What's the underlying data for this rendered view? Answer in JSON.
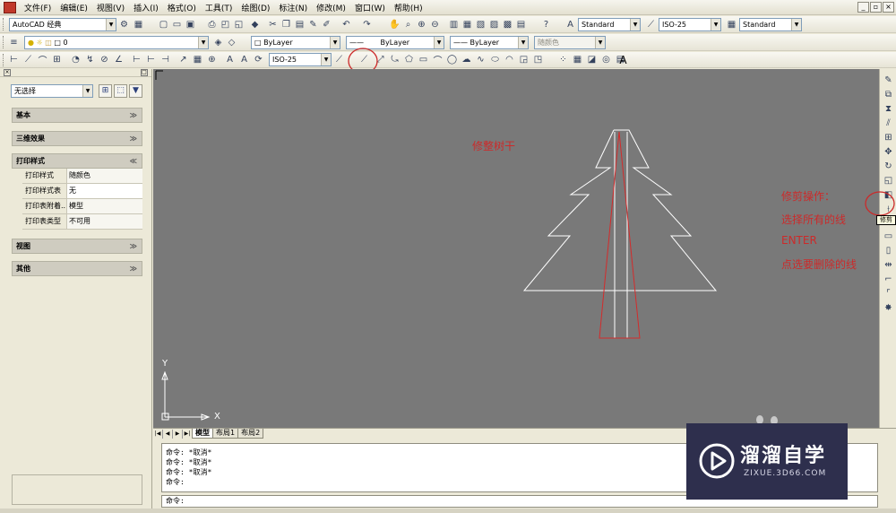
{
  "menubar": {
    "items": [
      "文件(F)",
      "编辑(E)",
      "视图(V)",
      "插入(I)",
      "格式(O)",
      "工具(T)",
      "绘图(D)",
      "标注(N)",
      "修改(M)",
      "窗口(W)",
      "帮助(H)"
    ],
    "window_controls": [
      "_",
      "▫",
      "×"
    ]
  },
  "toolbar1": {
    "workspace": "AutoCAD 经典",
    "text_style": "Standard",
    "dim_style": "ISO-25",
    "table_style": "Standard"
  },
  "toolbar2": {
    "layer": "0",
    "color": "ByLayer",
    "linetype": "ByLayer",
    "lineweight": "ByLayer",
    "plot_style": "随颜色"
  },
  "toolbar3": {
    "dim_style": "ISO-25",
    "text_icon": "A"
  },
  "palette": {
    "selection": "无选择",
    "sections": {
      "basic": "基本",
      "effects3d": "三维效果",
      "plot_style": "打印样式",
      "view": "视图",
      "misc": "其他"
    },
    "properties": [
      {
        "key": "打印样式",
        "value": "随颜色"
      },
      {
        "key": "打印样式表",
        "value": "无"
      },
      {
        "key": "打印表附着...",
        "value": "模型"
      },
      {
        "key": "打印表类型",
        "value": "不可用"
      }
    ]
  },
  "canvas": {
    "note_trim_trunk": "修整树干",
    "instructions": [
      "修剪操作：",
      "选择所有的线",
      "ENTER",
      "点选要删除的线"
    ],
    "axis_y": "Y",
    "axis_x": "X"
  },
  "right_toolbar": {
    "tooltip": "修剪"
  },
  "tabs": [
    "模型",
    "布局1",
    "布局2"
  ],
  "command": {
    "history": [
      "命令: *取消*",
      "命令: *取消*",
      "命令: *取消*",
      "命令:"
    ],
    "prompt": "命令:"
  },
  "watermark": {
    "title": "溜溜自学",
    "url": "ZIXUE.3D66.COM"
  },
  "colors": {
    "canvas_bg": "#797979",
    "annotation_red": "#cc2a2a",
    "tree_white": "#ffffff",
    "trunk_red": "#d42b2b",
    "watermark_bg": "#2e2f4d"
  }
}
